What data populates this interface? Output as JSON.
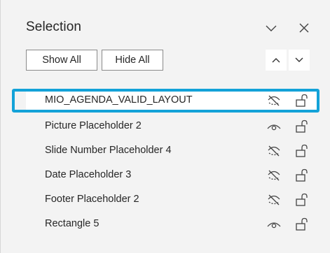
{
  "pane": {
    "title": "Selection",
    "chevron_icon": "chevron-down-icon",
    "close_icon": "close-icon"
  },
  "toolbar": {
    "show_all_label": "Show All",
    "hide_all_label": "Hide All",
    "bring_forward_icon": "chevron-up-icon",
    "send_backward_icon": "chevron-down-icon"
  },
  "items": [
    {
      "label": "MIO_AGENDA_VALID_LAYOUT",
      "visible": false,
      "locked": false,
      "selected": true
    },
    {
      "label": "Picture Placeholder 2",
      "visible": true,
      "locked": false,
      "selected": false
    },
    {
      "label": "Slide Number Placeholder 4",
      "visible": false,
      "locked": false,
      "selected": false
    },
    {
      "label": "Date Placeholder 3",
      "visible": false,
      "locked": false,
      "selected": false
    },
    {
      "label": "Footer Placeholder 2",
      "visible": false,
      "locked": false,
      "selected": false
    },
    {
      "label": "Rectangle 5",
      "visible": true,
      "locked": false,
      "selected": false
    }
  ],
  "colors": {
    "pane_background": "#f3f3f3",
    "selection_outline": "#13a2d8",
    "text": "#262626"
  }
}
